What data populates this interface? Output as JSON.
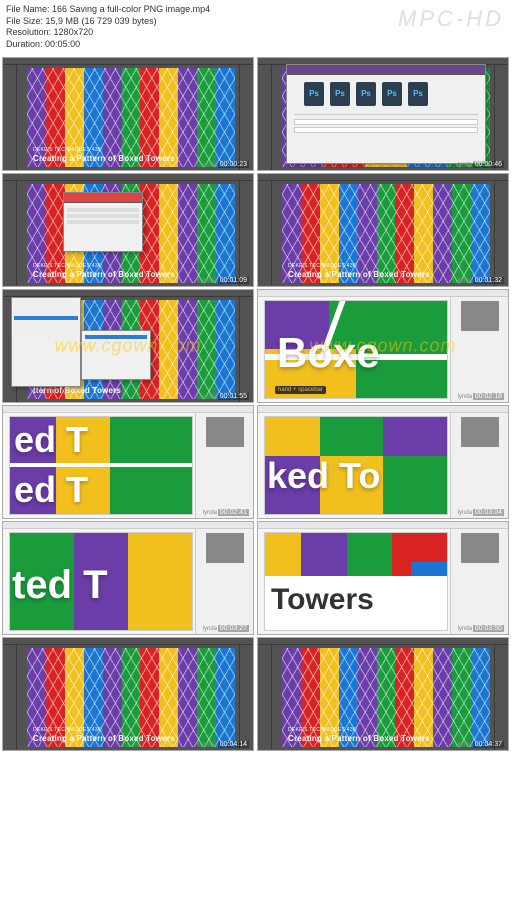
{
  "header": {
    "filename_label": "File Name:",
    "filename": "166 Saving a full-color PNG image.mp4",
    "filesize_label": "File Size:",
    "filesize": "15,9 MB (16 729 039 bytes)",
    "resolution_label": "Resolution:",
    "resolution": "1280x720",
    "duration_label": "Duration:",
    "duration": "00:05:00",
    "watermark": "MPC-HD"
  },
  "artwork": {
    "subtitle": "DEKE'S TECHNIQUES 436:",
    "title": "Creating a Pattern of Boxed Towers"
  },
  "thumbs": [
    {
      "ts": "00:00:23",
      "type": "full-pattern"
    },
    {
      "ts": "00:00:46",
      "type": "save-dialog"
    },
    {
      "ts": "00:01:09",
      "type": "small-dialog"
    },
    {
      "ts": "00:01:32",
      "type": "full-pattern"
    },
    {
      "ts": "00:01:55",
      "type": "menu-open"
    },
    {
      "ts": "00:02:18",
      "type": "zoom-boxe"
    },
    {
      "ts": "00:02:41",
      "type": "zoom-ed-t"
    },
    {
      "ts": "00:03:04",
      "type": "zoom-ked-to"
    },
    {
      "ts": "00:03:27",
      "type": "zoom-ted-t"
    },
    {
      "ts": "00:03:50",
      "type": "zoom-towers"
    },
    {
      "ts": "00:04:14",
      "type": "full-pattern"
    },
    {
      "ts": "00:04:37",
      "type": "full-pattern"
    }
  ],
  "zoom_text": {
    "boxe": "Boxe",
    "ed_t": "ed T",
    "ked_to": "ked To",
    "ted_t": "ted T",
    "towers": "Towers"
  },
  "tooltip": "hand + spacebar",
  "file_ext": "Ps",
  "lynda": "lynda",
  "cg_watermark": "www.cgown.com"
}
